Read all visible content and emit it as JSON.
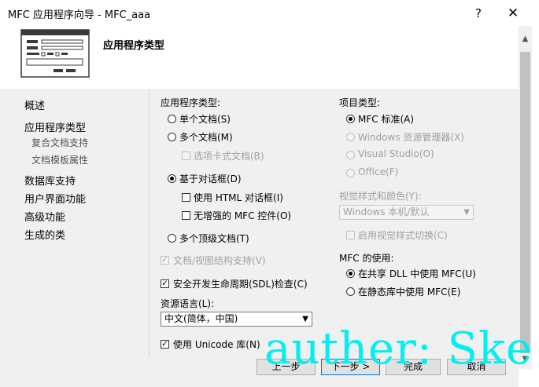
{
  "window": {
    "title": "MFC 应用程序向导 - MFC_aaa",
    "help": "?",
    "close": "✕"
  },
  "header": {
    "title": "应用程序类型"
  },
  "nav": {
    "items": [
      {
        "label": "概述"
      },
      {
        "label": "应用程序类型"
      },
      {
        "label": "复合文档支持"
      },
      {
        "label": "文档模板属性"
      },
      {
        "label": "数据库支持"
      },
      {
        "label": "用户界面功能"
      },
      {
        "label": "高级功能"
      },
      {
        "label": "生成的类"
      }
    ]
  },
  "app_type": {
    "heading": "应用程序类型:",
    "single_doc": "单个文档(S)",
    "multi_doc": "多个文档(M)",
    "tabbed_docs": "选项卡式文档(B)",
    "dialog_based": "基于对话框(D)",
    "use_html_dialog": "使用 HTML 对话框(I)",
    "no_enhanced_mfc": "无增强的 MFC 控件(O)",
    "multi_toplevel": "多个顶级文档(T)",
    "selected": "dialog_based"
  },
  "doc_view_support": "文档/视图结构支持(V)",
  "sdl_checks": "安全开发生命周期(SDL)检查(C)",
  "resource_language": {
    "label": "资源语言(L):",
    "value": "中文(简体，中国)"
  },
  "use_unicode": "使用 Unicode 库(N)",
  "project_type": {
    "heading": "项目类型:",
    "mfc_standard": "MFC 标准(A)",
    "windows_explorer": "Windows 资源管理器(X)",
    "visual_studio": "Visual Studio(O)",
    "office": "Office(F)"
  },
  "visual_style": {
    "label": "视觉样式和颜色(Y):",
    "value": "Windows 本机/默认",
    "enable_switching": "启用视觉样式切换(C)"
  },
  "mfc_use": {
    "heading": "MFC 的使用:",
    "shared_dll": "在共享 DLL 中使用 MFC(U)",
    "static_lib": "在静态库中使用 MFC(E)",
    "selected": "shared_dll"
  },
  "buttons": {
    "back": "上一步",
    "next": "下一步 >",
    "finish": "完成",
    "cancel": "取消"
  },
  "watermark": "auther: Ske",
  "icons": [
    "wizard-icon",
    "help-icon",
    "close-icon",
    "dropdown-arrow-icon",
    "scroll-up-icon",
    "scroll-down-icon"
  ]
}
